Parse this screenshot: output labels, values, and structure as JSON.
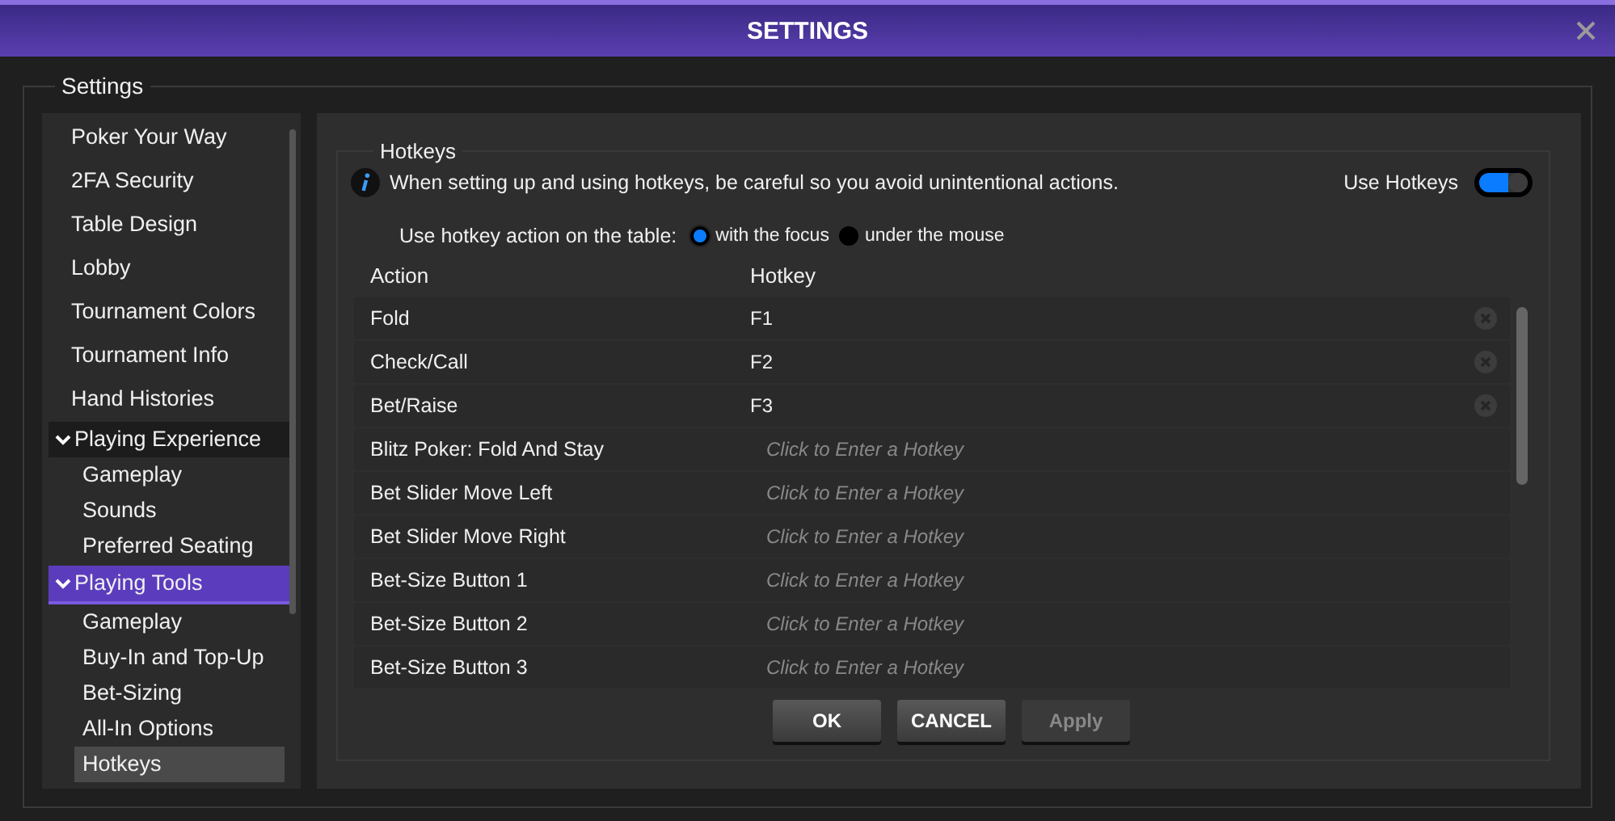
{
  "window": {
    "title": "SETTINGS"
  },
  "settings_group": {
    "legend": "Settings"
  },
  "sidebar": {
    "items": [
      {
        "kind": "item",
        "label": "Poker Your Way",
        "selected": false
      },
      {
        "kind": "item",
        "label": "2FA Security",
        "selected": false
      },
      {
        "kind": "item",
        "label": "Table Design",
        "selected": false
      },
      {
        "kind": "item",
        "label": "Lobby",
        "selected": false
      },
      {
        "kind": "item",
        "label": "Tournament Colors",
        "selected": false
      },
      {
        "kind": "item",
        "label": "Tournament Info",
        "selected": false
      },
      {
        "kind": "item",
        "label": "Hand Histories",
        "selected": false
      },
      {
        "kind": "group",
        "label": "Playing Experience",
        "selected": false,
        "expanded": true,
        "children": [
          {
            "label": "Gameplay",
            "selected": false
          },
          {
            "label": "Sounds",
            "selected": false
          },
          {
            "label": "Preferred Seating",
            "selected": false
          }
        ]
      },
      {
        "kind": "group",
        "label": "Playing Tools",
        "selected": true,
        "expanded": true,
        "children": [
          {
            "label": "Gameplay",
            "selected": false
          },
          {
            "label": "Buy-In and Top-Up",
            "selected": false
          },
          {
            "label": "Bet-Sizing",
            "selected": false
          },
          {
            "label": "All-In Options",
            "selected": false
          },
          {
            "label": "Hotkeys",
            "selected": true
          }
        ]
      }
    ]
  },
  "hotkeys": {
    "legend": "Hotkeys",
    "info": "When setting up and using hotkeys, be careful so you avoid unintentional actions.",
    "toggle": {
      "label": "Use Hotkeys",
      "on": true
    },
    "mode": {
      "label": "Use hotkey action on the table:",
      "options": [
        {
          "label": "with the focus",
          "selected": true
        },
        {
          "label": "under the mouse",
          "selected": false
        }
      ]
    },
    "table": {
      "columns": [
        "Action",
        "Hotkey"
      ],
      "rows": [
        {
          "action": "Fold",
          "hotkey": "F1"
        },
        {
          "action": "Check/Call",
          "hotkey": "F2"
        },
        {
          "action": "Bet/Raise",
          "hotkey": "F3"
        },
        {
          "action": "Blitz Poker: Fold And Stay",
          "placeholder": "Click to Enter a Hotkey"
        },
        {
          "action": "Bet Slider Move Left",
          "placeholder": "Click to Enter a Hotkey"
        },
        {
          "action": "Bet Slider Move Right",
          "placeholder": "Click to Enter a Hotkey"
        },
        {
          "action": "Bet-Size Button 1",
          "placeholder": "Click to Enter a Hotkey"
        },
        {
          "action": "Bet-Size Button 2",
          "placeholder": "Click to Enter a Hotkey"
        },
        {
          "action": "Bet-Size Button 3",
          "placeholder": "Click to Enter a Hotkey"
        }
      ]
    }
  },
  "buttons": [
    {
      "label": "OK",
      "disabled": false
    },
    {
      "label": "CANCEL",
      "disabled": false
    },
    {
      "label": "Apply",
      "disabled": true
    }
  ]
}
